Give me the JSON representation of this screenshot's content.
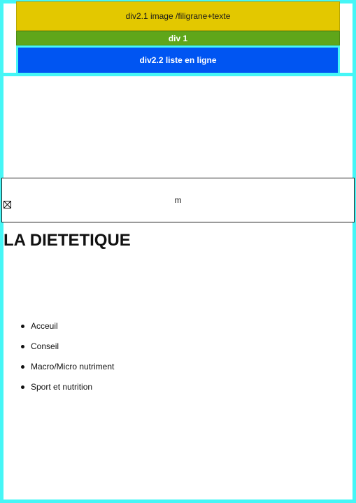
{
  "header": {
    "div21_label": "div2.1 image /filigrane+texte",
    "div1_label": "div 1",
    "div22_label": "div2.2 liste en ligne"
  },
  "marquee": {
    "text": "m",
    "broken_image_icon": "broken-image-icon"
  },
  "main": {
    "title": "LA DIETETIQUE"
  },
  "nav": {
    "items": [
      {
        "label": "Acceuil"
      },
      {
        "label": "Conseil"
      },
      {
        "label": "Macro/Micro nutriment"
      },
      {
        "label": "Sport et nutrition"
      }
    ]
  },
  "colors": {
    "frame_border": "#46f6f6",
    "div21_bg": "#e3c800",
    "div1_bg": "#5fa61a",
    "div22_bg": "#0055f2"
  }
}
